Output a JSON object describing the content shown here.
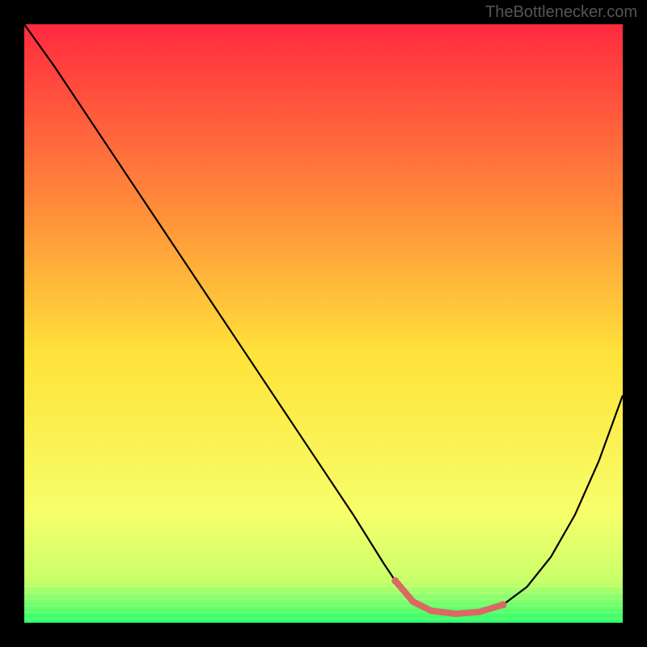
{
  "watermark": "TheBottlenecker.com",
  "chart_data": {
    "type": "line",
    "title": "",
    "xlabel": "",
    "ylabel": "",
    "xlim": [
      0,
      100
    ],
    "ylim": [
      0,
      100
    ],
    "background_gradient": {
      "top": "#ff2a3f",
      "mid_upper": "#ff8a3a",
      "mid": "#ffe23a",
      "mid_lower": "#f6ff6a",
      "bottom": "#2dff6a"
    },
    "series": [
      {
        "name": "bottleneck-curve",
        "color": "#000000",
        "x": [
          0,
          5,
          10,
          15,
          20,
          25,
          30,
          35,
          40,
          45,
          50,
          55,
          60,
          62,
          65,
          68,
          72,
          76,
          80,
          84,
          88,
          92,
          96,
          100
        ],
        "y": [
          100,
          93,
          85.5,
          78,
          70.5,
          63,
          55.5,
          48,
          40.5,
          33,
          25.5,
          18,
          10,
          7,
          3.5,
          2,
          1.5,
          1.8,
          3,
          6,
          11,
          18,
          27,
          38
        ]
      }
    ],
    "markers": [
      {
        "name": "optimal-zone-left",
        "x": 62,
        "y": 7,
        "r": 4.5,
        "color": "#d86a63"
      },
      {
        "name": "optimal-zone-mid1",
        "x": 65,
        "y": 3.5,
        "r": 3,
        "color": "#d86a63"
      },
      {
        "name": "optimal-zone-mid2",
        "x": 68,
        "y": 2,
        "r": 3,
        "color": "#d86a63"
      },
      {
        "name": "optimal-zone-mid3",
        "x": 72,
        "y": 1.5,
        "r": 3,
        "color": "#d86a63"
      },
      {
        "name": "optimal-zone-mid4",
        "x": 76,
        "y": 1.8,
        "r": 3,
        "color": "#d86a63"
      },
      {
        "name": "optimal-zone-right",
        "x": 80,
        "y": 3,
        "r": 4.5,
        "color": "#d86a63"
      }
    ],
    "optimal_stroke": {
      "color": "#d86a63",
      "width": 8,
      "x": [
        62,
        65,
        68,
        72,
        76,
        80
      ],
      "y": [
        7,
        3.5,
        2,
        1.5,
        1.8,
        3
      ]
    }
  }
}
